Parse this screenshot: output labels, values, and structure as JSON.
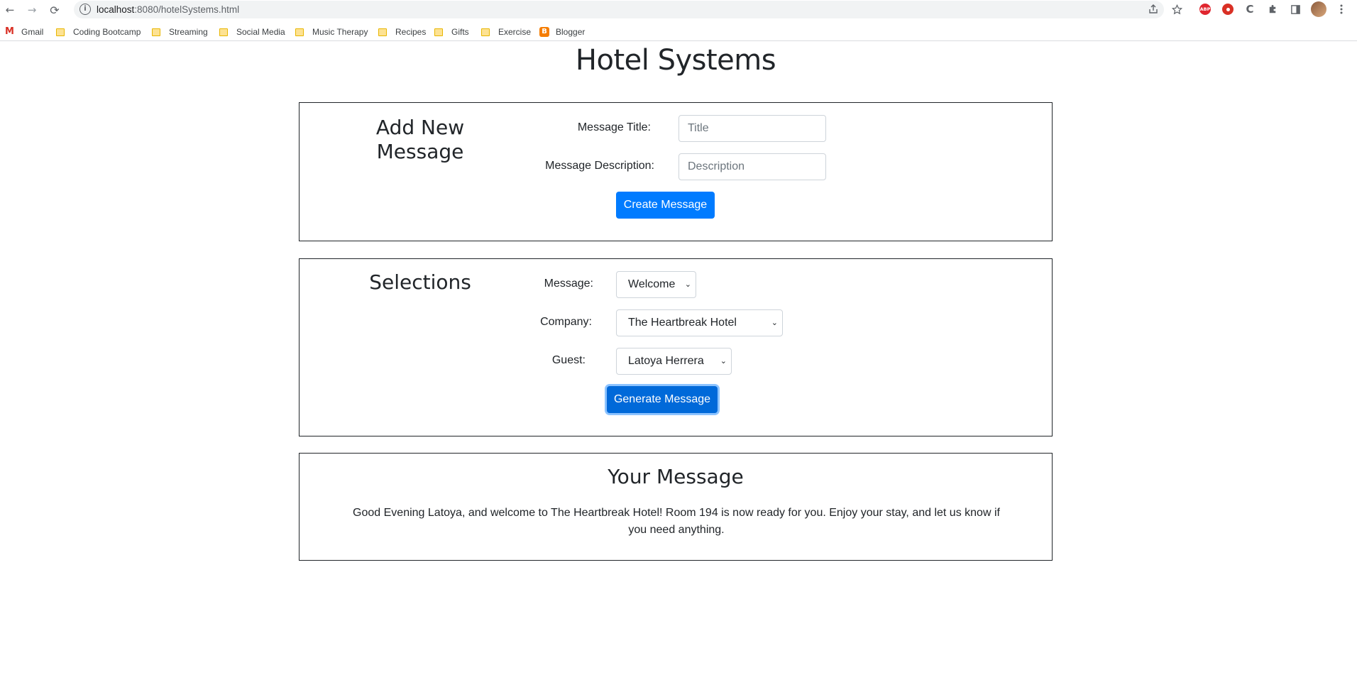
{
  "browser": {
    "url_host": "localhost",
    "url_rest": ":8080/hotelSystems.html",
    "back_glyph": "←",
    "forward_glyph": "→",
    "reload_glyph": "⟳",
    "info_glyph": "i",
    "abp_text": "ABP",
    "ext_c_text": "C",
    "bookmarks": [
      {
        "label": "Gmail",
        "icon": "gmail-icon"
      },
      {
        "label": "Coding Bootcamp",
        "icon": "folder-icon"
      },
      {
        "label": "Streaming",
        "icon": "folder-icon"
      },
      {
        "label": "Social Media",
        "icon": "folder-icon"
      },
      {
        "label": "Music Therapy",
        "icon": "folder-icon"
      },
      {
        "label": "Recipes",
        "icon": "folder-icon"
      },
      {
        "label": "Gifts",
        "icon": "folder-icon"
      },
      {
        "label": "Exercise",
        "icon": "folder-icon"
      },
      {
        "label": "Blogger",
        "icon": "blogger-icon"
      }
    ]
  },
  "page": {
    "title": "Hotel Systems"
  },
  "add_message": {
    "heading": "Add New Message",
    "title_label": "Message Title:",
    "title_placeholder": "Title",
    "description_label": "Message Description:",
    "description_placeholder": "Description",
    "create_button": "Create Message"
  },
  "selections": {
    "heading": "Selections",
    "message_label": "Message:",
    "message_value": "Welcome",
    "company_label": "Company:",
    "company_value": "The Heartbreak Hotel",
    "guest_label": "Guest:",
    "guest_value": "Latoya Herrera",
    "generate_button": "Generate Message"
  },
  "your_message": {
    "heading": "Your Message",
    "body": "Good Evening Latoya, and welcome to The Heartbreak Hotel! Room 194 is now ready for you. Enjoy your stay, and let us know if you need anything."
  },
  "colors": {
    "primary": "#007bff",
    "border": "#212529",
    "input_border": "#ced4da"
  }
}
